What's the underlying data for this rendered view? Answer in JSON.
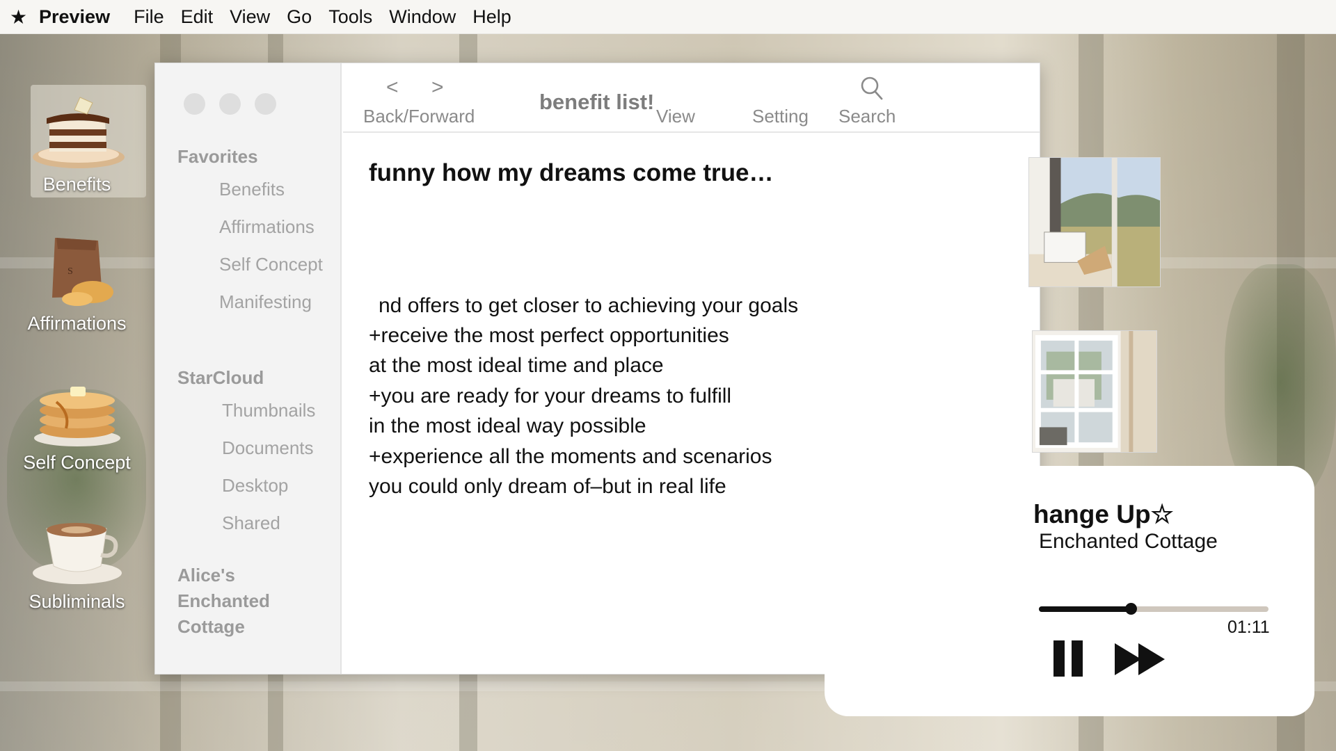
{
  "menubar": {
    "app_name": "Preview",
    "items": [
      "File",
      "Edit",
      "View",
      "Go",
      "Tools",
      "Window",
      "Help"
    ]
  },
  "desktop_icons": [
    {
      "label": "Benefits",
      "icon": "tiramisu-icon"
    },
    {
      "label": "Affirmations",
      "icon": "bread-bag-icon"
    },
    {
      "label": "Self Concept",
      "icon": "pancakes-icon"
    },
    {
      "label": "Subliminals",
      "icon": "coffee-cup-icon"
    }
  ],
  "sidebar": {
    "favorites_title": "Favorites",
    "favorites": [
      "Benefits",
      "Affirmations",
      "Self Concept",
      "Manifesting"
    ],
    "cloud_title": "StarCloud",
    "cloud": [
      "Thumbnails",
      "Documents",
      "Desktop",
      "Shared"
    ],
    "footer": [
      "Alice's",
      "Enchanted",
      "Cottage"
    ]
  },
  "toolbar": {
    "back_glyph": "<",
    "forward_glyph": ">",
    "nav_label": "Back/Forward",
    "title": "benefit list!",
    "view_label": "View",
    "setting_label": "Setting",
    "search_label": "Search"
  },
  "content": {
    "heading": "funny how my dreams come true…",
    "lines": [
      "nd offers to get closer to achieving your goals",
      "+receive the most perfect opportunities",
      "at the most ideal time and place",
      "+you are ready for your dreams to fulfill",
      "in the most ideal way possible",
      "+experience all the moments and scenarios",
      "you could only dream of–but in real life"
    ]
  },
  "player": {
    "song": "hange Up☆",
    "artist": "Enchanted Cottage",
    "time": "01:11",
    "progress": 0.4
  },
  "colors": {
    "menubar_bg": "#f7f6f3",
    "sidebar_bg": "#f3f3f3",
    "sidebar_text": "#a3a3a3",
    "player_bg": "#ffffff"
  }
}
